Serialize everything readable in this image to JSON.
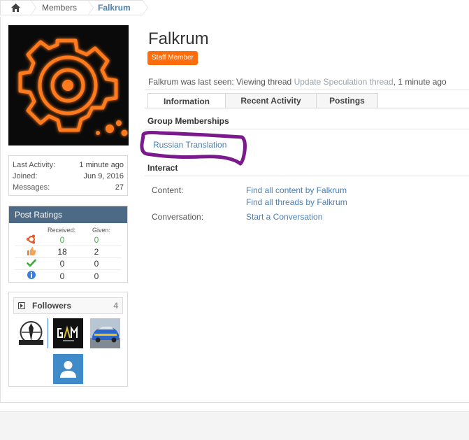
{
  "breadcrumb": {
    "home_icon": "home-icon",
    "items": [
      "Members",
      "Falkrum"
    ]
  },
  "sidebar": {
    "stats": [
      {
        "label": "Last Activity:",
        "value": "1 minute ago"
      },
      {
        "label": "Joined:",
        "value": "Jun 9, 2016"
      },
      {
        "label": "Messages:",
        "value": "27"
      }
    ],
    "post_ratings": {
      "title": "Post Ratings",
      "col_received": "Received:",
      "col_given": "Given:",
      "rows": [
        {
          "icon": "ubuntu-icon",
          "received": "0",
          "given": "0"
        },
        {
          "icon": "thumbs-up-icon",
          "received": "18",
          "given": "2"
        },
        {
          "icon": "checkmark-icon",
          "received": "0",
          "given": "0"
        },
        {
          "icon": "info-icon",
          "received": "0",
          "given": "0"
        }
      ]
    },
    "followers": {
      "title": "Followers",
      "count": "4"
    }
  },
  "profile": {
    "name": "Falkrum",
    "badge": "Staff Member",
    "last_seen_prefix": "Falkrum was last seen: Viewing thread",
    "last_seen_link": "Update Speculation thread",
    "last_seen_suffix": ", 1 minute ago"
  },
  "tabs": [
    {
      "label": "Information",
      "active": true
    },
    {
      "label": "Recent Activity",
      "active": false
    },
    {
      "label": "Postings",
      "active": false
    }
  ],
  "group_memberships": {
    "title": "Group Memberships",
    "items": [
      "Russian Translation"
    ]
  },
  "interact": {
    "title": "Interact",
    "content_label": "Content:",
    "content_links": [
      "Find all content by Falkrum",
      "Find all threads by Falkrum"
    ],
    "conversation_label": "Conversation:",
    "conversation_link": "Start a Conversation"
  },
  "colors": {
    "accent_link": "#4a7fb0",
    "staff_badge": "#ff6c0c",
    "ratings_header": "#4c6a85",
    "annotation": "#7a1a8c"
  }
}
